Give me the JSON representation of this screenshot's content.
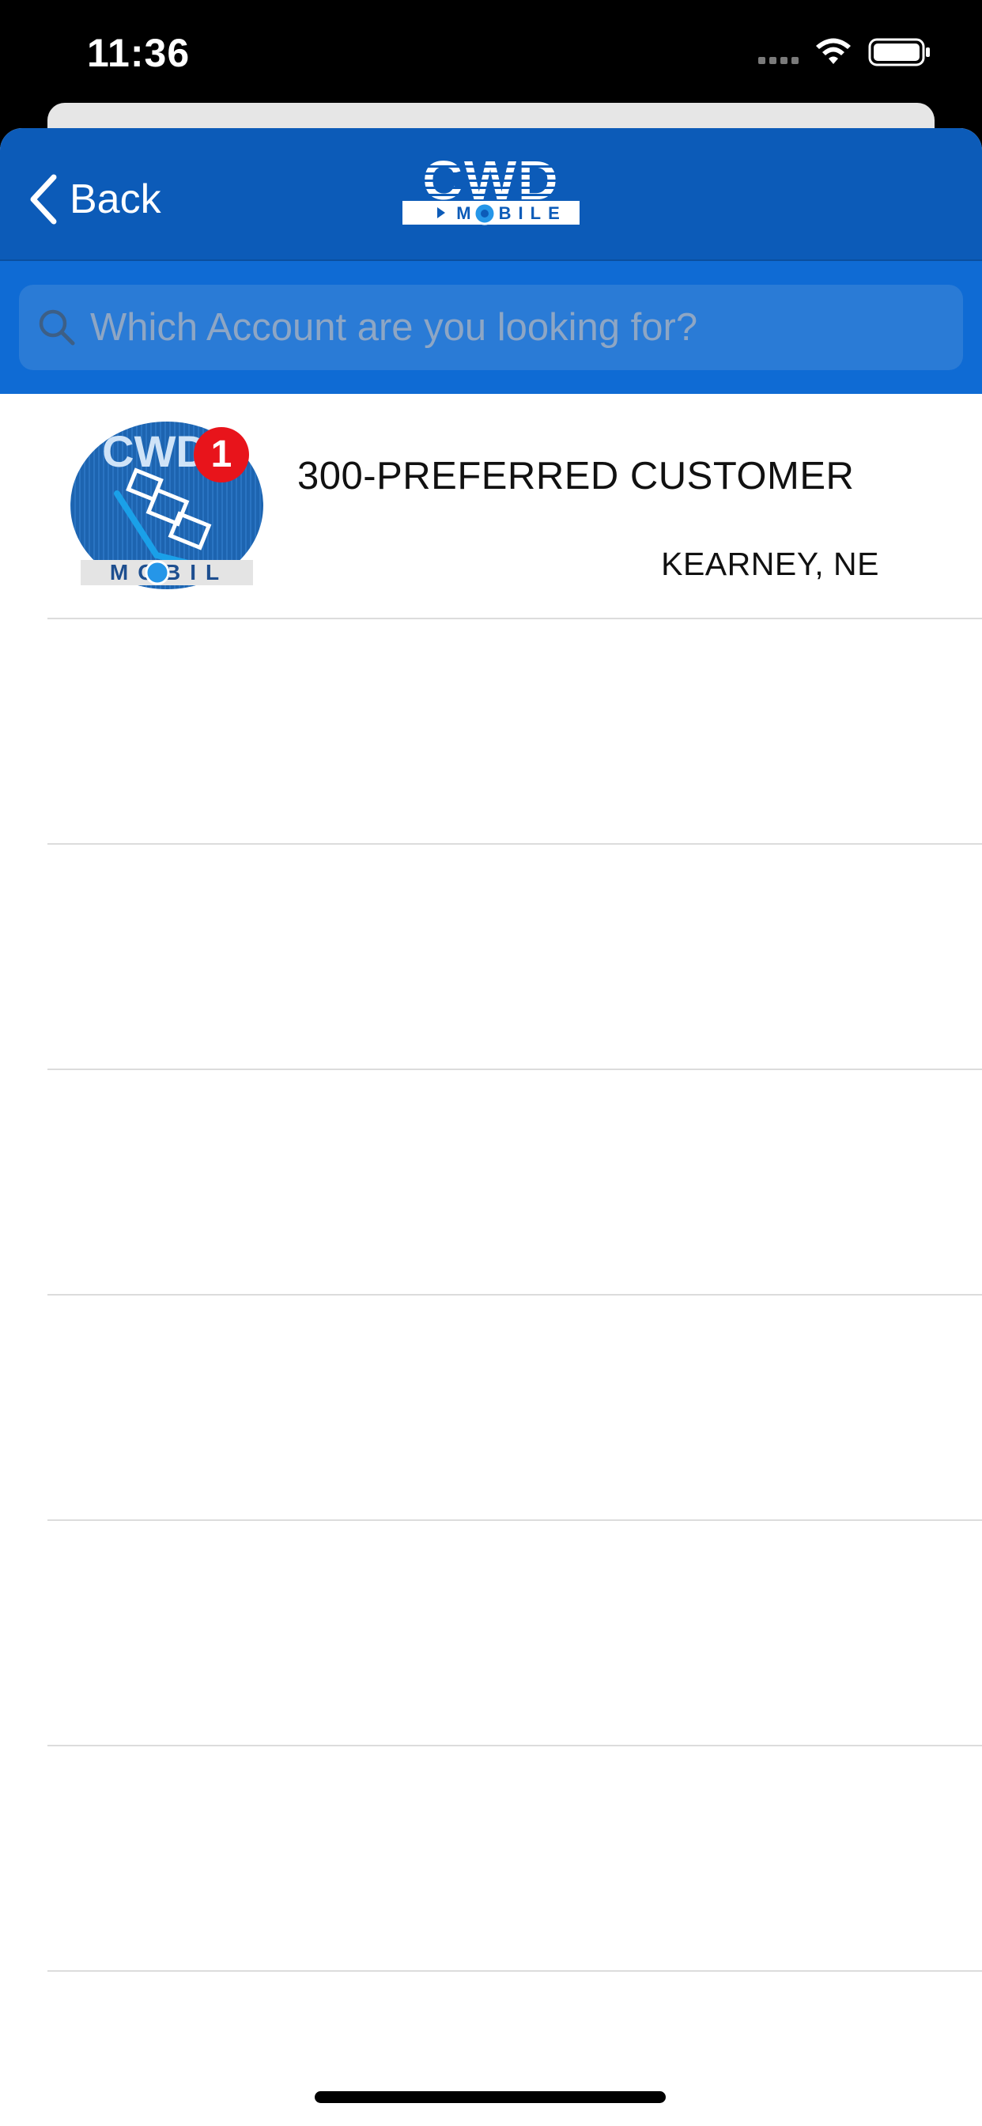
{
  "status_bar": {
    "time": "11:36"
  },
  "nav": {
    "back_label": "Back",
    "logo_text": "CWD",
    "logo_subtext": "MOBILE"
  },
  "search": {
    "placeholder": "Which Account are you looking for?",
    "value": ""
  },
  "accounts": [
    {
      "name": "300-PREFERRED CUSTOMER",
      "location": "KEARNEY, NE",
      "badge": "1",
      "avatar_text": "CWD",
      "avatar_subtext": "MOBILE"
    }
  ],
  "colors": {
    "nav_bg": "#0c5bb8",
    "search_bg": "#0f6bd4",
    "badge": "#e8141b"
  }
}
